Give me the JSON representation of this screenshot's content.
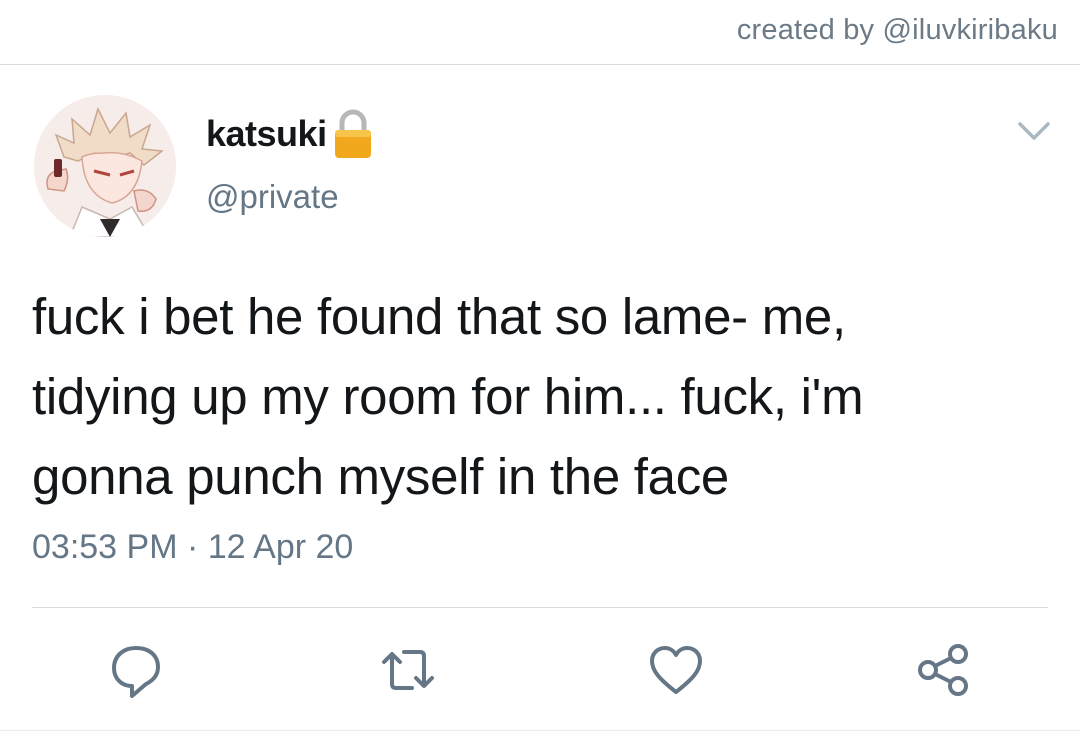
{
  "header": {
    "credit": "created by @iluvkiribaku"
  },
  "tweet": {
    "display_name": "katsuki",
    "handle": "@private",
    "text_lines": [
      "fuck i bet he found that so lame- me,",
      "tidying up my room for him... fuck, i'm",
      "gonna punch myself in the face"
    ],
    "time": "03:53 PM",
    "separator": "·",
    "date": "12 Apr 20"
  },
  "icons": {
    "lock": "lock-icon",
    "chevron": "chevron-down-icon",
    "reply": "reply-icon",
    "retweet": "retweet-icon",
    "like": "heart-icon",
    "share": "share-icon"
  },
  "colors": {
    "text": "#14171a",
    "muted": "#657786",
    "divider": "#d6dde2",
    "lock_gold": "#f2a81d"
  }
}
